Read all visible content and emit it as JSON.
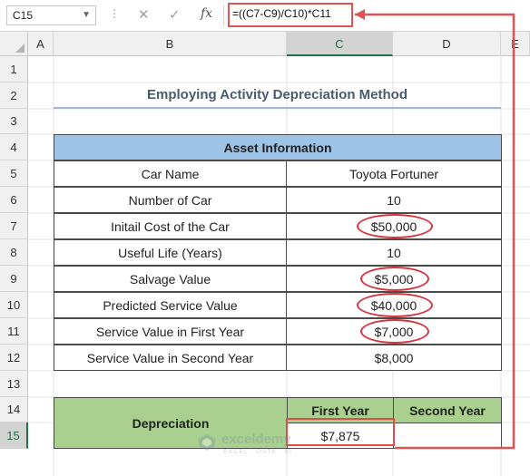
{
  "formula_bar": {
    "name_box": "C15",
    "divider": "⋮",
    "cancel_icon": "✕",
    "enter_icon": "✓",
    "fx_label": "fx",
    "formula": "=((C7-C9)/C10)*C11"
  },
  "columns": [
    "A",
    "B",
    "C",
    "D",
    "E"
  ],
  "rows": [
    "1",
    "2",
    "3",
    "4",
    "5",
    "6",
    "7",
    "8",
    "9",
    "10",
    "11",
    "12",
    "13",
    "14",
    "15"
  ],
  "selected_cell": "C15",
  "title": "Employing Activity Depreciation Method",
  "asset_table": {
    "header": "Asset Information",
    "rows": [
      {
        "label": "Car Name",
        "value": "Toyota Fortuner",
        "circled": false
      },
      {
        "label": "Number of Car",
        "value": "10",
        "circled": false
      },
      {
        "label": "Initail Cost of the Car",
        "value": "$50,000",
        "circled": true
      },
      {
        "label": "Useful Life (Years)",
        "value": "10",
        "circled": false
      },
      {
        "label": "Salvage Value",
        "value": "$5,000",
        "circled": true
      },
      {
        "label": "Predicted Service Value",
        "value": "$40,000",
        "circled": true
      },
      {
        "label": "Service Value in First Year",
        "value": "$7,000",
        "circled": true
      },
      {
        "label": "Service Value in Second Year",
        "value": "$8,000",
        "circled": false
      }
    ]
  },
  "depreciation_table": {
    "label": "Depreciation",
    "headers": [
      "First Year",
      "Second Year"
    ],
    "values": [
      "$7,875",
      ""
    ]
  },
  "colors": {
    "header_blue": "#9dc3e6",
    "header_green": "#a9d08e",
    "annotation_red": "#d9343d",
    "title_text": "#4d5a6a"
  },
  "watermark": {
    "name": "exceldemy",
    "tagline": "EXCEL · DATA · BI"
  }
}
